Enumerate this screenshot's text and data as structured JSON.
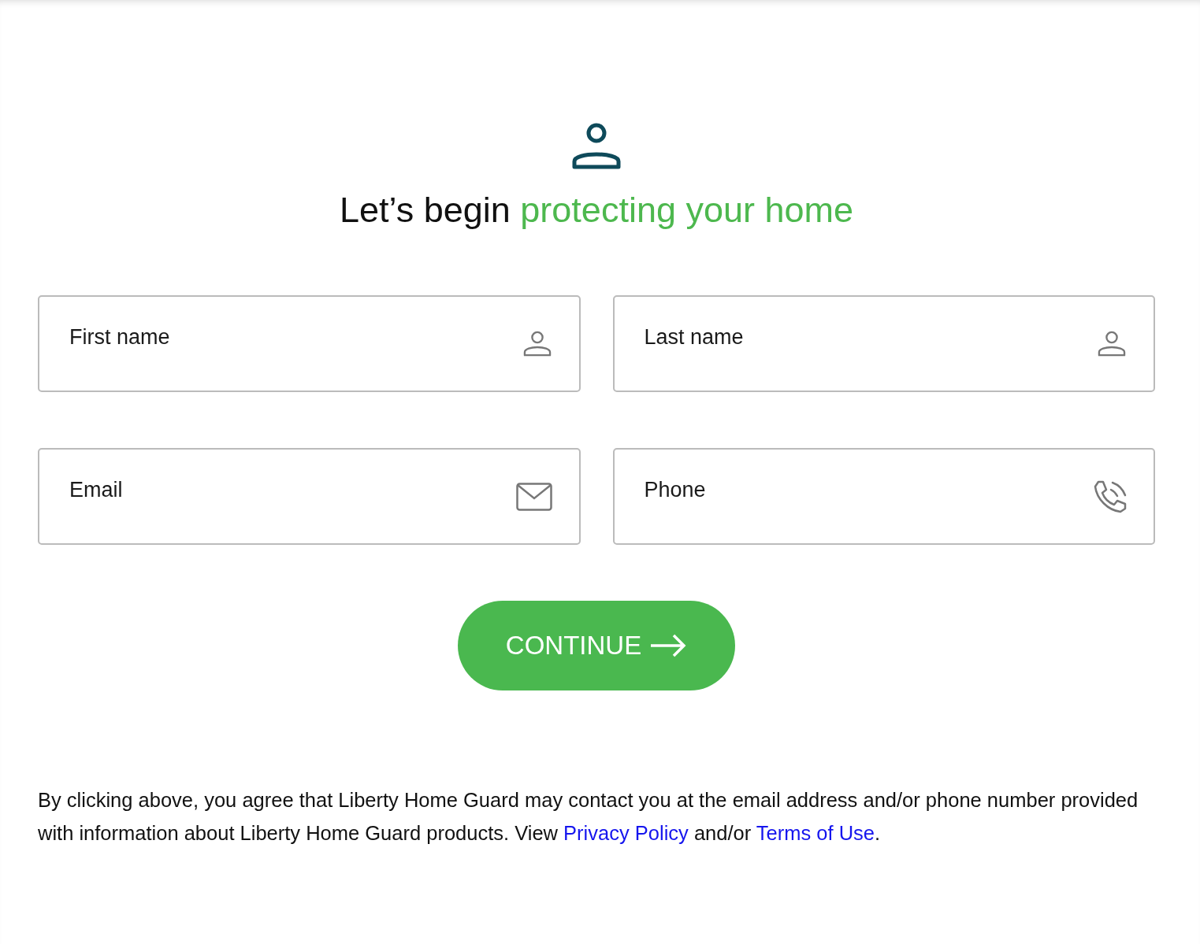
{
  "heading": {
    "text": "Let’s begin",
    "highlight": "protecting your home"
  },
  "fields": [
    {
      "placeholder": "First name",
      "kind": "person"
    },
    {
      "placeholder": "Last name",
      "kind": "person"
    },
    {
      "placeholder": "Email",
      "kind": "email"
    },
    {
      "placeholder": "Phone",
      "kind": "phone"
    }
  ],
  "button": {
    "label": "CONTINUE"
  },
  "consent": {
    "text": "By clicking above, you agree that Liberty Home Guard may contact you at the email address and/or phone number provided with information about Liberty Home Guard products. View",
    "privacy_link": "Privacy Policy",
    "between": "and/or",
    "terms_link": "Terms of Use",
    "end": "."
  }
}
